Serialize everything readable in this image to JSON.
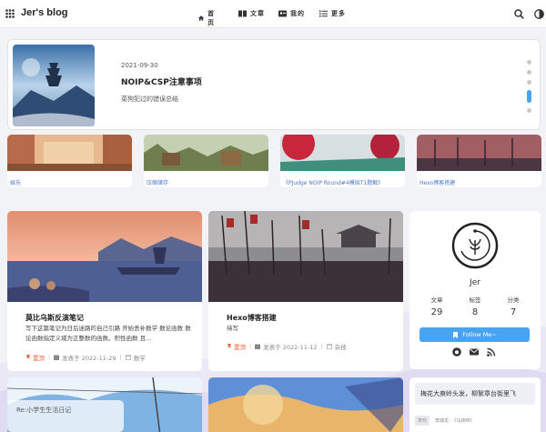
{
  "nav": {
    "blog_title": "Jer's blog",
    "home": "首页",
    "articles": "文章",
    "mine": "我的",
    "more": "更多"
  },
  "hero": {
    "date": "2021-09-30",
    "title": "NOIP&CSP注意事项",
    "desc": "菜狗犯过的错误总结"
  },
  "categories": [
    {
      "label": "娱乐"
    },
    {
      "label": "压缩储存"
    },
    {
      "label": "《PJudge NOIP Round#4模拟T1题解》"
    },
    {
      "label": "Hexo博客搭建"
    }
  ],
  "posts": [
    {
      "title": "莫比乌斯反演笔记",
      "desc": "写下这篇笔记为日后迷路的自己引路 开始丢补数学 数论函数 数论函数指定义域为正整数的函数。积性函数 且...",
      "tag": "置顶",
      "published": "发表于 2022-11-29",
      "category": "数学"
    },
    {
      "title": "Hexo博客搭建",
      "desc": "待写",
      "tag": "置顶",
      "published": "发表于 2022-11-12",
      "category": "杂技"
    }
  ],
  "profile": {
    "name": "Jer",
    "stats": [
      {
        "label": "文章",
        "value": "29"
      },
      {
        "label": "标签",
        "value": "8"
      },
      {
        "label": "分类",
        "value": "7"
      }
    ],
    "follow": "Follow Me~"
  },
  "quote": {
    "text": "梅花大庾岭头发，柳絮章台街里飞",
    "badge": "宋代",
    "source": "李端龙 -《乌夜啼》"
  },
  "overlay": {
    "text": "Re:小学生生活日记"
  },
  "colors": {
    "accent": "#49a3f0",
    "tag": "#e8623a",
    "link": "#4a78c8"
  }
}
